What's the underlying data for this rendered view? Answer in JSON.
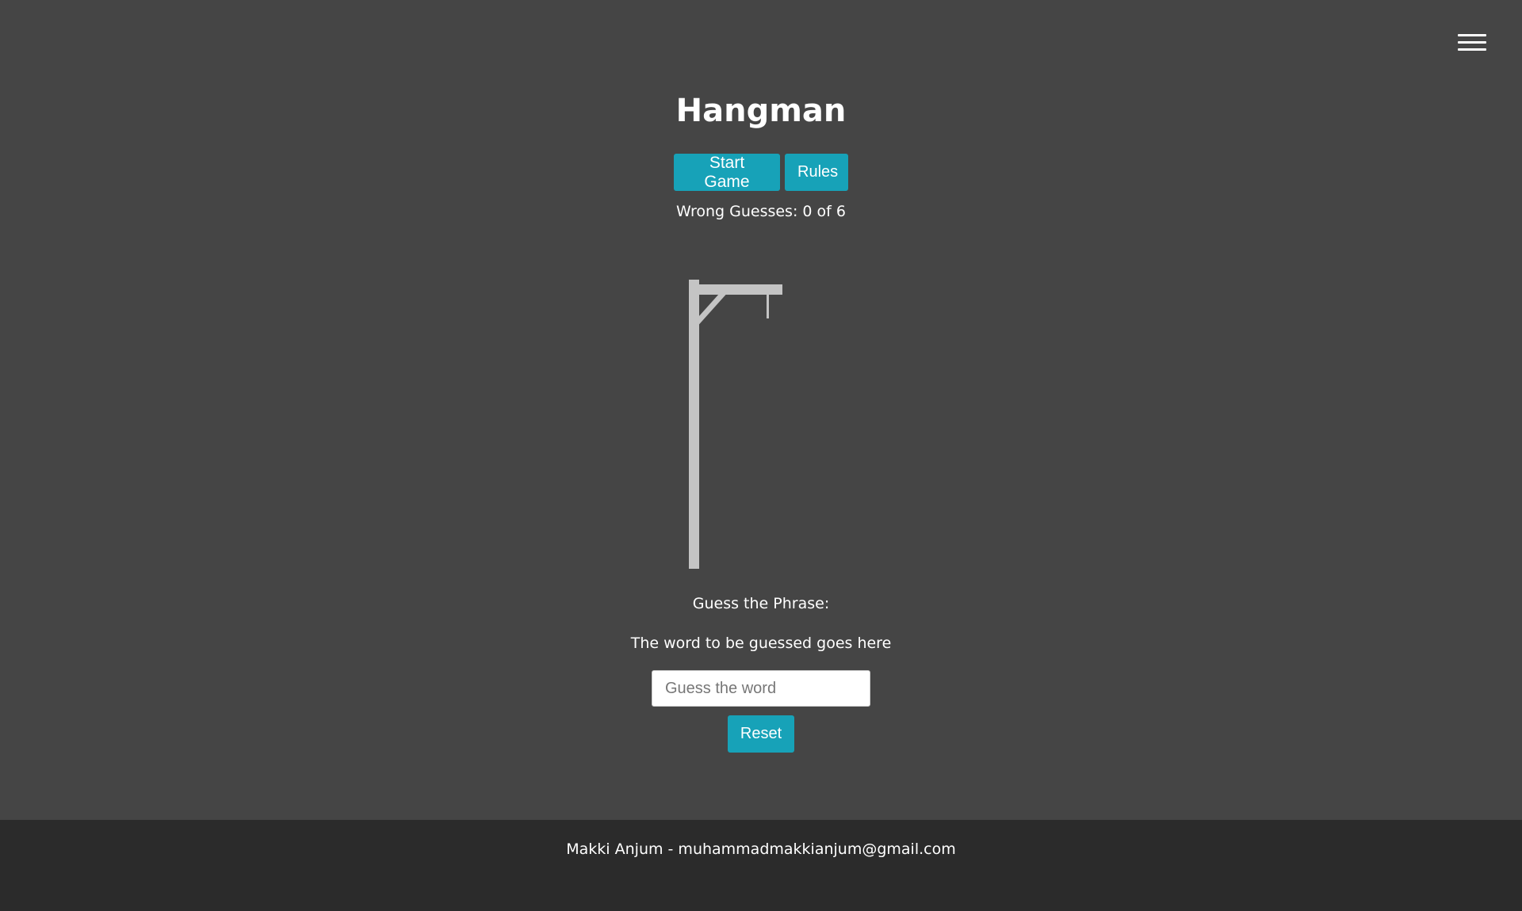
{
  "header": {
    "menu_icon": "hamburger-menu-icon",
    "title": "Hangman"
  },
  "controls": {
    "start_label": "Start Game",
    "rules_label": "Rules",
    "button_color": "#17a2b8"
  },
  "status": {
    "wrong_guesses_text": "Wrong Guesses: 0 of 6",
    "wrong_guesses": 0,
    "max_guesses": 6
  },
  "gallows": {
    "icon": "gallows-icon",
    "color": "#c4c4c4"
  },
  "phrase": {
    "label": "Guess the Phrase:",
    "word": "The word to be guessed goes here"
  },
  "guess": {
    "value": "",
    "placeholder": "Guess the word",
    "reset_label": "Reset"
  },
  "footer": {
    "text": "Makki Anjum - muhammadmakkianjum@gmail.com"
  }
}
